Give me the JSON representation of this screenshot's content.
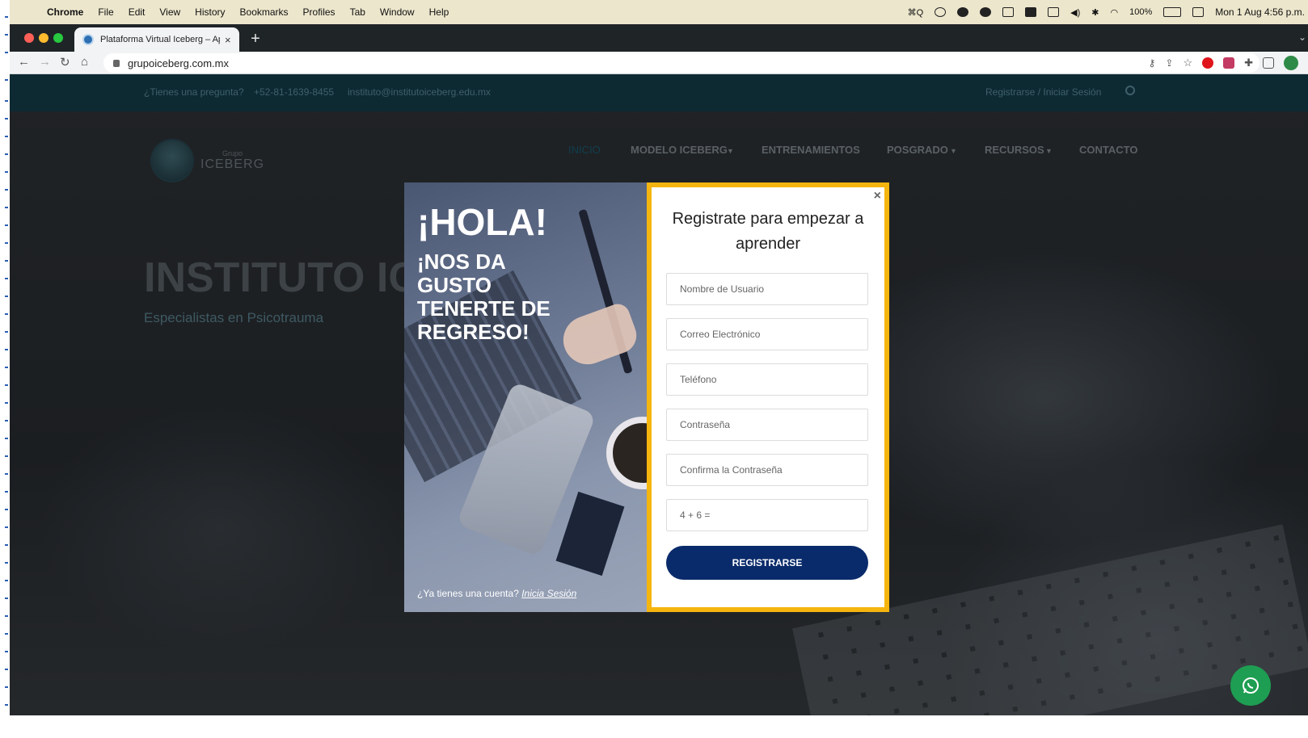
{
  "menubar": {
    "app": "Chrome",
    "items": [
      "File",
      "Edit",
      "View",
      "History",
      "Bookmarks",
      "Profiles",
      "Tab",
      "Window",
      "Help"
    ],
    "shortcut": "⌘Q",
    "battery": "100%",
    "clock": "Mon 1 Aug  4:56 p.m."
  },
  "browser": {
    "tab_title": "Plataforma Virtual Iceberg – Ap",
    "tab_close": "×",
    "new_tab": "+",
    "url": "grupoiceberg.com.mx"
  },
  "site": {
    "topbar": {
      "question": "¿Tienes una pregunta?",
      "phone": "+52-81-1639-8455",
      "email": "instituto@institutoiceberg.edu.mx",
      "login": "Registrarse / Iniciar Sesión"
    },
    "logo": {
      "small": "Grupo",
      "big": "ICEBERG"
    },
    "nav": [
      "INICIO",
      "MODELO ICEBERG",
      "ENTRENAMIENTOS",
      "POSGRADO",
      "RECURSOS",
      "CONTACTO"
    ],
    "hero_title": "INSTITUTO IC",
    "hero_subtitle": "Especialistas en Psicotrauma"
  },
  "modal": {
    "hola": "¡HOLA!",
    "gusto": "¡NOS DA GUSTO TENERTE DE REGRESO!",
    "have_account": "¿Ya tienes una cuenta?",
    "login_link": "Inicia Sesión",
    "close": "×",
    "form_title": "Registrate para empezar a aprender",
    "fields": {
      "username": "Nombre de Usuario",
      "email": "Correo Electrónico",
      "phone": "Teléfono",
      "password": "Contraseña",
      "confirm": "Confirma la Contraseña",
      "captcha": "4 + 6 ="
    },
    "submit": "REGISTRARSE"
  },
  "colors": {
    "accent_border": "#f5b50f",
    "button": "#0a2b6b",
    "whatsapp": "#1e9e52"
  }
}
